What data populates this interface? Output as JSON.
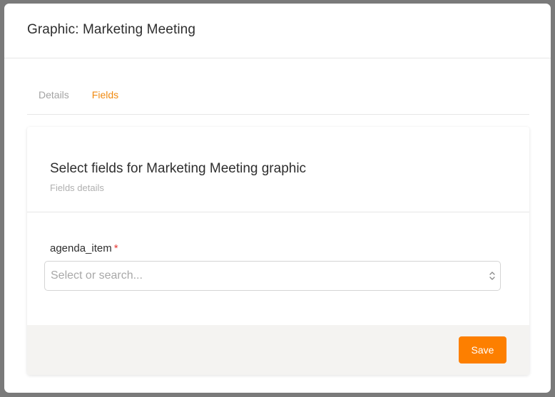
{
  "modal": {
    "title": "Graphic: Marketing Meeting"
  },
  "tabs": [
    {
      "label": "Details",
      "active": false
    },
    {
      "label": "Fields",
      "active": true
    }
  ],
  "card": {
    "title": "Select fields for Marketing Meeting graphic",
    "subtitle": "Fields details"
  },
  "form": {
    "field_label": "agenda_item",
    "required_mark": "*",
    "select_value": "",
    "select_placeholder": "Select or search...",
    "select_icon": "chevron-up-down-icon"
  },
  "footer": {
    "save_label": "Save"
  },
  "colors": {
    "accent": "#fd7f00",
    "active_tab": "#f08a10",
    "required": "#e53935",
    "footer_bg": "#f4f3f1"
  }
}
